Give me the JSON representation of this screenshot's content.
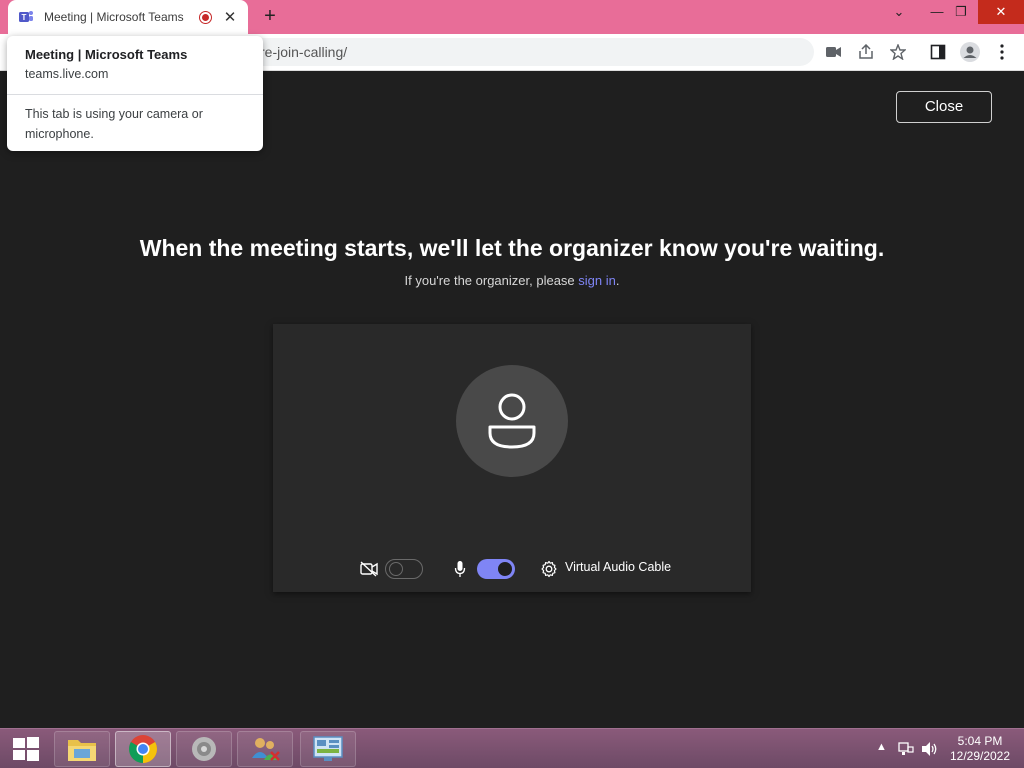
{
  "browser": {
    "tab_title": "Meeting | Microsoft Teams",
    "url_partial": "re-join-calling/",
    "new_tab": "+",
    "tab_close": "✕"
  },
  "popup": {
    "title": "Meeting | Microsoft Teams",
    "host": "teams.live.com",
    "message": "This tab is using your camera or microphone."
  },
  "page": {
    "close_label": "Close",
    "headline": "When the meeting starts, we'll let the organizer know you're waiting.",
    "sub_prefix": "If you're the organizer, please ",
    "sub_link": "sign in",
    "sub_suffix": ".",
    "camera_on": false,
    "mic_on": true,
    "audio_device": "Virtual Audio Cable"
  },
  "taskbar": {
    "time": "5:04 PM",
    "date": "12/29/2022"
  },
  "colors": {
    "titlebar": "#e86d98",
    "accent": "#7f85f5",
    "background": "#1f1f1f"
  }
}
